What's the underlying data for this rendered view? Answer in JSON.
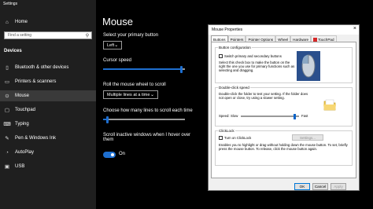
{
  "settings": {
    "window_title": "Settings",
    "nav_home": "Home",
    "search_placeholder": "Find a setting",
    "section_title": "Devices",
    "nav_items": [
      {
        "label": "Bluetooth & other devices",
        "icon": "bluetooth-icon"
      },
      {
        "label": "Printers & scanners",
        "icon": "printer-icon"
      },
      {
        "label": "Mouse",
        "icon": "mouse-icon"
      },
      {
        "label": "Touchpad",
        "icon": "touchpad-icon"
      },
      {
        "label": "Typing",
        "icon": "keyboard-icon"
      },
      {
        "label": "Pen & Windows Ink",
        "icon": "pen-icon"
      },
      {
        "label": "AutoPlay",
        "icon": "autoplay-icon"
      },
      {
        "label": "USB",
        "icon": "usb-icon"
      }
    ],
    "active_item": "Mouse"
  },
  "mouse_page": {
    "title": "Mouse",
    "primary_button_label": "Select your primary button",
    "primary_button_value": "Left",
    "cursor_speed_label": "Cursor speed",
    "cursor_speed_level": 0.95,
    "scroll_label": "Roll the mouse wheel to scroll",
    "scroll_value": "Multiple lines at a time",
    "lines_label": "Choose how many lines to scroll each time",
    "lines_level": 0.05,
    "inactive_label": "Scroll inactive windows when I hover over them",
    "inactive_state": "On",
    "accent_color": "#1e6fd0"
  },
  "dialog": {
    "title": "Mouse Properties",
    "close": "×",
    "tabs": [
      "Buttons",
      "Pointers",
      "Pointer Options",
      "Wheel",
      "Hardware",
      "TouchPad"
    ],
    "active_tab": "Buttons",
    "button_config": {
      "title": "Button configuration",
      "checkbox_label": "Switch primary and secondary buttons",
      "description": "Select this check box to make the button on the right the one you use for primary functions such as selecting and dragging."
    },
    "double_click": {
      "title": "Double-click speed",
      "description": "Double-click the folder to test your setting. If the folder does not open or close, try using a slower setting.",
      "speed_label": "Speed:",
      "slow_label": "Slow",
      "fast_label": "Fast",
      "speed_level": 0.9
    },
    "clicklock": {
      "title": "ClickLock",
      "checkbox_label": "Turn on ClickLock",
      "settings_button": "Settings...",
      "description": "Enables you to highlight or drag without holding down the mouse button. To set, briefly press the mouse button. To release, click the mouse button again."
    },
    "buttons": {
      "ok": "OK",
      "cancel": "Cancel",
      "apply": "Apply"
    }
  }
}
